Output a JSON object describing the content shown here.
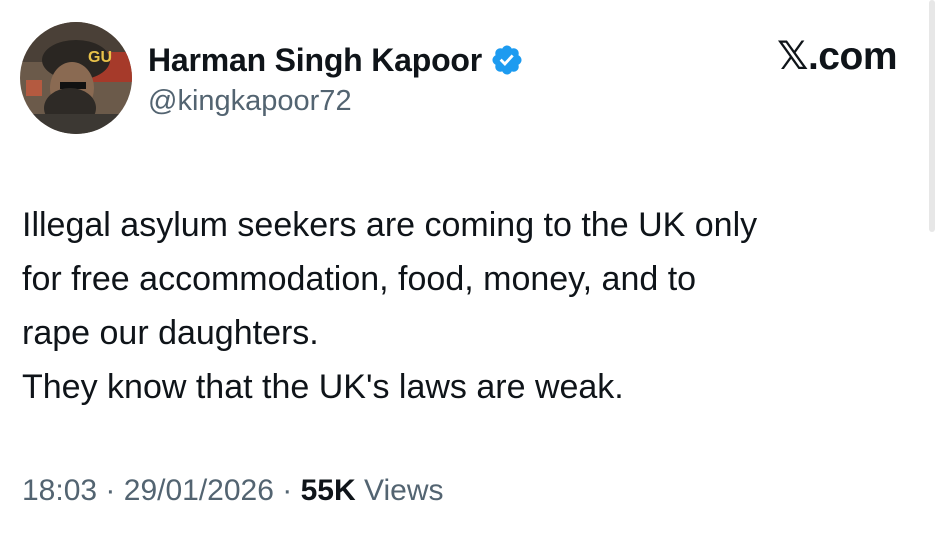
{
  "author": {
    "display_name": "Harman Singh Kapoor",
    "handle": "@kingkapoor72",
    "avatar_icon": "profile-photo",
    "verified_icon": "verified-badge-icon",
    "verified_color": "#1d9bf0"
  },
  "brand": {
    "label": "𝕏.com"
  },
  "tweet": {
    "lines": [
      "Illegal asylum seekers are coming to the UK only",
      "for free accommodation, food, money, and to",
      "rape our daughters.",
      "They know that the UK's laws are weak."
    ]
  },
  "meta": {
    "time": "18:03",
    "separator": "·",
    "date": "29/01/2026",
    "views_count": "55K",
    "views_label": "Views"
  }
}
